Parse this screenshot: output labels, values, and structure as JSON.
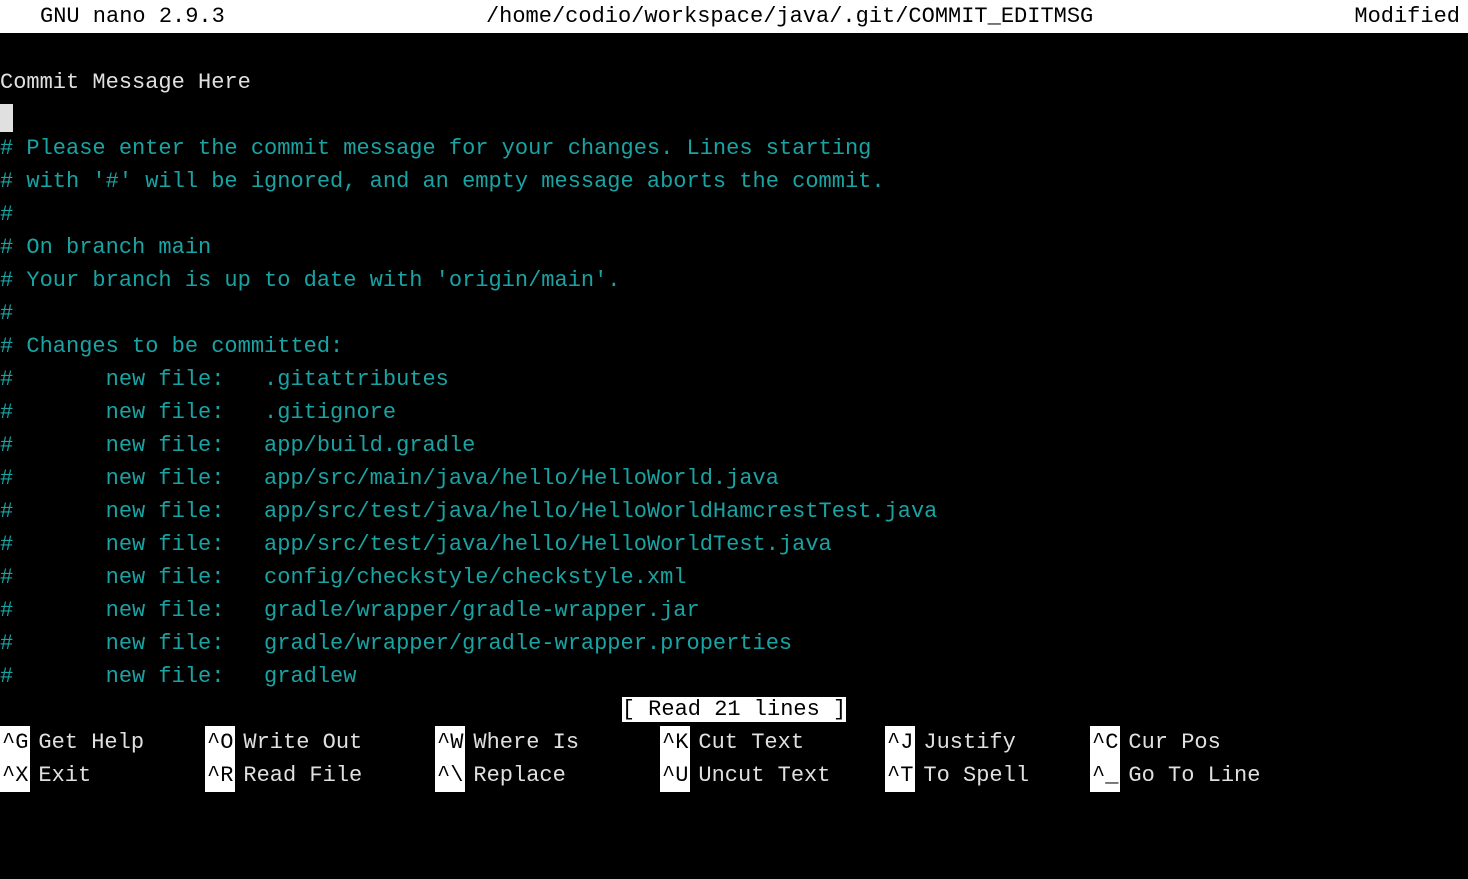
{
  "titleBar": {
    "appName": "GNU nano 2.9.3",
    "filePath": "/home/codio/workspace/java/.git/COMMIT_EDITMSG",
    "status": "Modified"
  },
  "editor": {
    "commitMessage": "Commit Message Here",
    "comments": [
      "# Please enter the commit message for your changes. Lines starting",
      "# with '#' will be ignored, and an empty message aborts the commit.",
      "#",
      "# On branch main",
      "# Your branch is up to date with 'origin/main'.",
      "#",
      "# Changes to be committed:",
      "#       new file:   .gitattributes",
      "#       new file:   .gitignore",
      "#       new file:   app/build.gradle",
      "#       new file:   app/src/main/java/hello/HelloWorld.java",
      "#       new file:   app/src/test/java/hello/HelloWorldHamcrestTest.java",
      "#       new file:   app/src/test/java/hello/HelloWorldTest.java",
      "#       new file:   config/checkstyle/checkstyle.xml",
      "#       new file:   gradle/wrapper/gradle-wrapper.jar",
      "#       new file:   gradle/wrapper/gradle-wrapper.properties",
      "#       new file:   gradlew"
    ]
  },
  "statusLine": "[ Read 21 lines ]",
  "shortcuts": {
    "row1": [
      {
        "key": "^G",
        "desc": "Get Help"
      },
      {
        "key": "^O",
        "desc": "Write Out"
      },
      {
        "key": "^W",
        "desc": "Where Is"
      },
      {
        "key": "^K",
        "desc": "Cut Text"
      },
      {
        "key": "^J",
        "desc": "Justify"
      },
      {
        "key": "^C",
        "desc": "Cur Pos"
      }
    ],
    "row2": [
      {
        "key": "^X",
        "desc": "Exit"
      },
      {
        "key": "^R",
        "desc": "Read File"
      },
      {
        "key": "^\\",
        "desc": "Replace"
      },
      {
        "key": "^U",
        "desc": "Uncut Text"
      },
      {
        "key": "^T",
        "desc": "To Spell"
      },
      {
        "key": "^_",
        "desc": "Go To Line"
      }
    ]
  }
}
